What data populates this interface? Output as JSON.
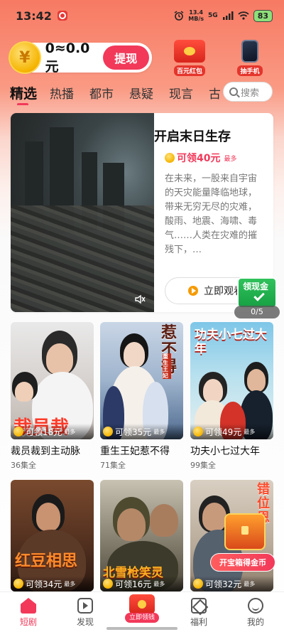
{
  "status_bar": {
    "time": "13:42",
    "speed_value": "13.4",
    "speed_unit": "MB/s",
    "network": "5G",
    "battery": "83"
  },
  "header": {
    "coin_symbol": "¥",
    "balance": "0≈0.0元",
    "withdraw_label": "提现",
    "promo_redpack_label": "百元红包",
    "promo_phone_label": "抽手机"
  },
  "tabs": [
    {
      "label": "精选",
      "active": true
    },
    {
      "label": "热播"
    },
    {
      "label": "都市"
    },
    {
      "label": "悬疑"
    },
    {
      "label": "现言"
    },
    {
      "label": "古"
    }
  ],
  "search": {
    "placeholder": "搜索"
  },
  "feature": {
    "title": "开启末日生存",
    "reward": "可领40元",
    "reward_max": "最多",
    "description": "在未来，一股来自宇宙的天灾能量降临地球，带来无穷无尽的灾难，酸雨、地震、海啸、毒气……人类在灾难的摧残下，…",
    "watch_label": "立即观看"
  },
  "cash_widget": {
    "label": "领现金",
    "progress": "0/5"
  },
  "dramas": [
    {
      "title": "裁员裁到主动脉",
      "episodes": "36集全",
      "reward": "可领18元",
      "reward_max": "最多",
      "poster_art": "裁员裁"
    },
    {
      "title": "重生王妃惹不得",
      "episodes": "71集全",
      "reward": "可领35元",
      "reward_max": "最多",
      "poster_art": "惹不得",
      "poster_sub": "重生王妃"
    },
    {
      "title": "功夫小七过大年",
      "episodes": "99集全",
      "reward": "可领49元",
      "reward_max": "最多",
      "poster_art": "功夫小七过大年"
    },
    {
      "title": "",
      "episodes": "",
      "reward": "可领34元",
      "reward_max": "最多",
      "poster_art": "红豆相思"
    },
    {
      "title": "",
      "episodes": "",
      "reward": "可领16元",
      "reward_max": "最多",
      "poster_art": "北雪枪笑灵"
    },
    {
      "title": "",
      "episodes": "",
      "reward": "可领32元",
      "reward_max": "最多",
      "poster_art": "错位恩"
    }
  ],
  "treasure": {
    "label": "开宝箱得金币"
  },
  "bottom_nav": {
    "items": [
      {
        "label": "短剧",
        "active": true
      },
      {
        "label": "发现"
      },
      {
        "label": ""
      },
      {
        "label": "福利"
      },
      {
        "label": "我的"
      }
    ],
    "center_label": "立即领钱"
  }
}
